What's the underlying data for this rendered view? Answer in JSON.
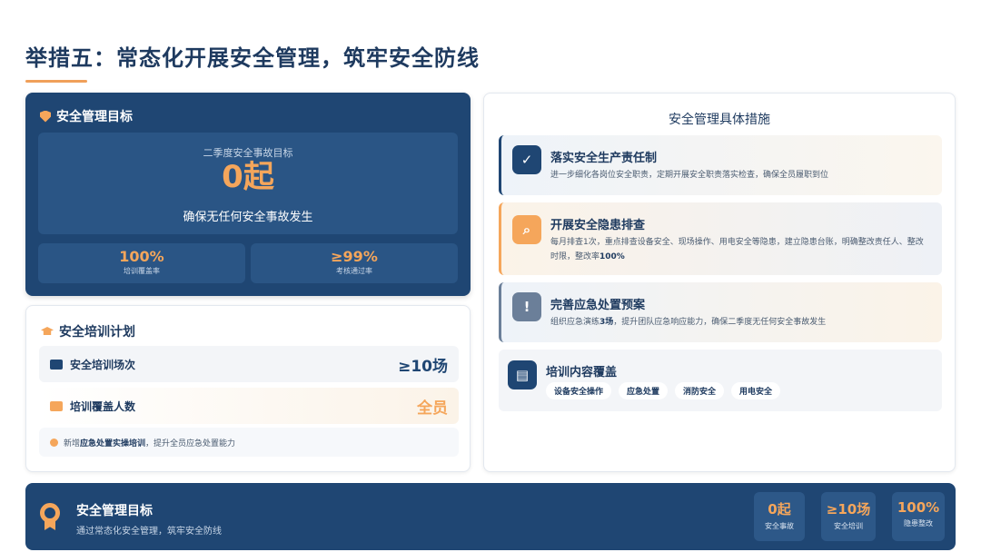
{
  "page": {
    "title": "举措五：常态化开展安全管理，筑牢安全防线"
  },
  "goal_card": {
    "heading": "安全管理目标",
    "target_label": "二季度安全事故目标",
    "target_value": "0起",
    "target_desc": "确保无任何安全事故发生",
    "stats": [
      {
        "value": "100%",
        "label": "培训覆盖率"
      },
      {
        "value": "≥99%",
        "label": "考核通过率"
      }
    ]
  },
  "training_card": {
    "heading": "安全培训计划",
    "rows": [
      {
        "label": "安全培训场次",
        "value": "≥10场"
      },
      {
        "label": "培训覆盖人数",
        "value": "全员"
      }
    ],
    "note_prefix": "新增",
    "note_bold": "应急处置实操培训",
    "note_suffix": "，提升全员应急处置能力"
  },
  "measures_card": {
    "heading": "安全管理具体措施",
    "items": [
      {
        "title": "落实安全生产责任制",
        "desc": "进一步细化各岗位安全职责，定期开展安全职责落实检查，确保全员履职到位"
      },
      {
        "title": "开展安全隐患排查",
        "desc_prefix": "每月排查1次，重点排查设备安全、现场操作、用电安全等隐患，建立隐患台账，明确整改责任人、整改时限，整改率",
        "desc_bold": "100%"
      },
      {
        "title": "完善应急处置预案",
        "desc_prefix": "组织应急演练",
        "desc_bold": "3场",
        "desc_suffix": "，提升团队应急响应能力，确保二季度无任何安全事故发生"
      },
      {
        "title": "培训内容覆盖",
        "tags": [
          "设备安全操作",
          "应急处置",
          "消防安全",
          "用电安全"
        ]
      }
    ]
  },
  "bottom_bar": {
    "title": "安全管理目标",
    "subtitle": "通过常态化安全管理，筑牢安全防线",
    "stats": [
      {
        "value": "0起",
        "label": "安全事故"
      },
      {
        "value": "≥10场",
        "label": "安全培训"
      },
      {
        "value": "100%",
        "label": "隐患整改"
      }
    ]
  },
  "colors": {
    "navy": "#1f4673",
    "accent_orange": "#f5a65b",
    "text_dark": "#1e3a5f"
  },
  "icons": [
    "shield-icon",
    "graduation-cap-icon",
    "calendar-icon",
    "people-icon",
    "user-check-icon",
    "search-icon",
    "alarm-icon",
    "clipboard-icon",
    "medal-icon"
  ]
}
